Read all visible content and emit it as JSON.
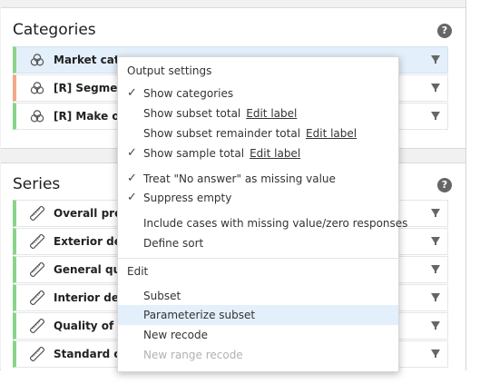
{
  "categories_panel": {
    "title": "Categories",
    "help": "?",
    "rows": [
      {
        "label": "Market categ",
        "icon": "venn-icon",
        "accent": "#8ad489"
      },
      {
        "label": "[R] Segment d",
        "icon": "venn-icon",
        "accent": "#f2a98a"
      },
      {
        "label": "[R] Make of m",
        "icon": "venn-icon",
        "accent": "#8ad489"
      }
    ]
  },
  "series_panel": {
    "title": "Series",
    "help": "?",
    "rows": [
      {
        "label": "Overall produ",
        "icon": "ruler-icon"
      },
      {
        "label": "Exterior desig",
        "icon": "ruler-icon"
      },
      {
        "label": "General quali",
        "icon": "ruler-icon"
      },
      {
        "label": "Interior desig",
        "icon": "ruler-icon"
      },
      {
        "label": "Quality of int",
        "icon": "ruler-icon"
      },
      {
        "label": "Standard of e",
        "icon": "ruler-icon"
      }
    ]
  },
  "menu": {
    "output_header": "Output settings",
    "show_categories": "Show categories",
    "show_subset_total": "Show subset total",
    "show_subset_total_link": "Edit label",
    "show_subset_remainder": "Show subset remainder total",
    "show_subset_remainder_link": "Edit label",
    "show_sample_total": "Show sample total",
    "show_sample_total_link": "Edit label",
    "treat_no_answer": "Treat \"No answer\" as missing value",
    "suppress_empty": "Suppress empty",
    "include_cases": "Include cases with missing value/zero responses",
    "define_sort": "Define sort",
    "edit_header": "Edit",
    "subset": "Subset",
    "parameterize_subset": "Parameterize subset",
    "new_recode": "New recode",
    "new_range_recode": "New range recode",
    "checkmark": "✓"
  },
  "colors": {
    "accent_green": "#8ad489",
    "accent_orange": "#f2a98a",
    "selection": "#e3effa"
  }
}
